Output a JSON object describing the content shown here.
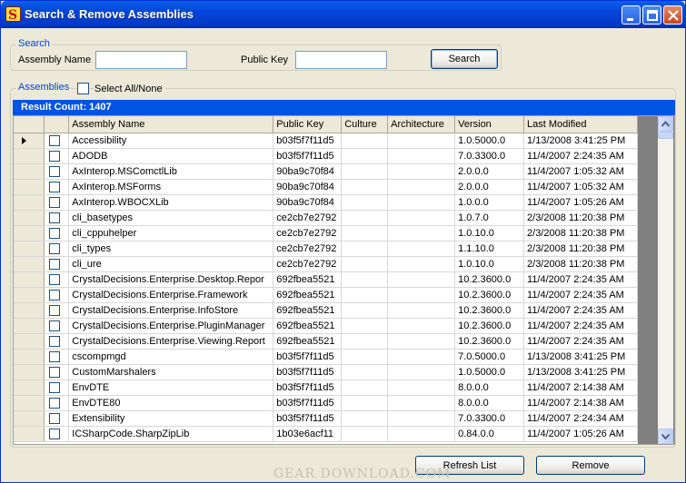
{
  "window": {
    "title": "Search & Remove Assemblies"
  },
  "search": {
    "legend": "Search",
    "assembly_name_label": "Assembly Name",
    "assembly_name_value": "",
    "public_key_label": "Public Key",
    "public_key_value": "",
    "search_button": "Search"
  },
  "assemblies": {
    "legend": "Assemblies",
    "select_all_label": "Select All/None",
    "result_count": "Result Count: 1407"
  },
  "table": {
    "columns": [
      "Assembly Name",
      "Public Key",
      "Culture",
      "Architecture",
      "Version",
      "Last Modified"
    ],
    "rows": [
      [
        "Accessibility",
        "b03f5f7f11d5",
        "",
        "",
        "1.0.5000.0",
        "1/13/2008 3:41:25 PM"
      ],
      [
        "ADODB",
        "b03f5f7f11d5",
        "",
        "",
        "7.0.3300.0",
        "11/4/2007 2:24:35 AM"
      ],
      [
        "AxInterop.MSComctlLib",
        "90ba9c70f84",
        "",
        "",
        "2.0.0.0",
        "11/4/2007 1:05:32 AM"
      ],
      [
        "AxInterop.MSForms",
        "90ba9c70f84",
        "",
        "",
        "2.0.0.0",
        "11/4/2007 1:05:32 AM"
      ],
      [
        "AxInterop.WBOCXLib",
        "90ba9c70f84",
        "",
        "",
        "1.0.0.0",
        "11/4/2007 1:05:26 AM"
      ],
      [
        "cli_basetypes",
        "ce2cb7e2792",
        "",
        "",
        "1.0.7.0",
        "2/3/2008 11:20:38 PM"
      ],
      [
        "cli_cppuhelper",
        "ce2cb7e2792",
        "",
        "",
        "1.0.10.0",
        "2/3/2008 11:20:38 PM"
      ],
      [
        "cli_types",
        "ce2cb7e2792",
        "",
        "",
        "1.1.10.0",
        "2/3/2008 11:20:38 PM"
      ],
      [
        "cli_ure",
        "ce2cb7e2792",
        "",
        "",
        "1.0.10.0",
        "2/3/2008 11:20:38 PM"
      ],
      [
        "CrystalDecisions.Enterprise.Desktop.Repor",
        "692fbea5521",
        "",
        "",
        "10.2.3600.0",
        "11/4/2007 2:24:35 AM"
      ],
      [
        "CrystalDecisions.Enterprise.Framework",
        "692fbea5521",
        "",
        "",
        "10.2.3600.0",
        "11/4/2007 2:24:35 AM"
      ],
      [
        "CrystalDecisions.Enterprise.InfoStore",
        "692fbea5521",
        "",
        "",
        "10.2.3600.0",
        "11/4/2007 2:24:35 AM"
      ],
      [
        "CrystalDecisions.Enterprise.PluginManager",
        "692fbea5521",
        "",
        "",
        "10.2.3600.0",
        "11/4/2007 2:24:35 AM"
      ],
      [
        "CrystalDecisions.Enterprise.Viewing.Report",
        "692fbea5521",
        "",
        "",
        "10.2.3600.0",
        "11/4/2007 2:24:35 AM"
      ],
      [
        "cscompmgd",
        "b03f5f7f11d5",
        "",
        "",
        "7.0.5000.0",
        "1/13/2008 3:41:25 PM"
      ],
      [
        "CustomMarshalers",
        "b03f5f7f11d5",
        "",
        "",
        "1.0.5000.0",
        "1/13/2008 3:41:25 PM"
      ],
      [
        "EnvDTE",
        "b03f5f7f11d5",
        "",
        "",
        "8.0.0.0",
        "11/4/2007 2:14:38 AM"
      ],
      [
        "EnvDTE80",
        "b03f5f7f11d5",
        "",
        "",
        "8.0.0.0",
        "11/4/2007 2:14:38 AM"
      ],
      [
        "Extensibility",
        "b03f5f7f11d5",
        "",
        "",
        "7.0.3300.0",
        "11/4/2007 2:24:34 AM"
      ],
      [
        "ICSharpCode.SharpZipLib",
        "1b03e6acf11",
        "",
        "",
        "0.84.0.0",
        "11/4/2007 1:05:26 AM"
      ]
    ]
  },
  "footer": {
    "refresh_button": "Refresh List",
    "remove_button": "Remove",
    "watermark": "GEAR DOWNLOAD.COM"
  }
}
